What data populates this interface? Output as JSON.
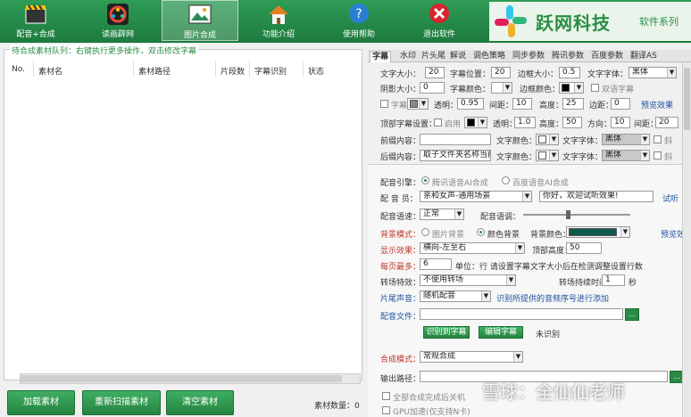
{
  "toolbar": {
    "buttons": [
      {
        "label": "配音+合成"
      },
      {
        "label": "读画辟网"
      },
      {
        "label": "图片合成"
      },
      {
        "label": "功能介绍"
      },
      {
        "label": "使用帮助"
      },
      {
        "label": "退出软件"
      }
    ],
    "brand_name": "跃网科技",
    "brand_sub": "软件系列"
  },
  "queue": {
    "title": "待合成素材队列：右键执行更多操作，双击修改字幕",
    "columns": [
      "No.",
      "素材名",
      "素材路径",
      "片段数",
      "字幕识别",
      "状态"
    ],
    "buttons": [
      "加载素材",
      "重新扫描素材",
      "清空素材"
    ],
    "count_label": "素材数量：0"
  },
  "tabs": [
    "字幕",
    "水印",
    "片头尾",
    "解说",
    "调色策略",
    "同步参数",
    "腾讯参数",
    "百度参数",
    "翻译AS"
  ],
  "subtitle": {
    "row1": {
      "size_label": "文字大小：",
      "size": "20",
      "pos_label": "字幕位置：",
      "pos": "20",
      "border_label": "边框大小：",
      "border": "0.5",
      "font_label": "文字字体：",
      "font": "黑体"
    },
    "row2": {
      "shadow_label": "阴影大小：",
      "shadow": "0",
      "color_label": "字幕颜色：",
      "bcolor_label": "边框颜色：",
      "bilingual_label": "双语字幕"
    },
    "row3": {
      "bg_label": "字幕底",
      "opacity_label": "透明：",
      "opacity": "0.95",
      "spacing_label": "间距：",
      "spacing": "10",
      "height_label": "高度：",
      "height": "25",
      "margin_label": "边距：",
      "margin": "0",
      "link": "预览效果"
    },
    "row4": {
      "extra_label": "顶部字幕设置：",
      "enable_label": "启用",
      "opacity_label": "透明：",
      "opacity": "1.0",
      "height_label": "高度：",
      "height": "50",
      "direction_label": "方向：",
      "direction": "10",
      "spacing_label": "间距：",
      "spacing": "20"
    },
    "row5": {
      "front_label": "前缀内容：",
      "front": "",
      "color_label": "文字颜色：",
      "font_label": "文字字体：",
      "font": "黑体",
      "italic_label": "斜"
    },
    "row6": {
      "back_label": "后缀内容：",
      "back": "取子文件夹名称当前标",
      "color_label": "文字颜色：",
      "font_label": "文字字体：",
      "font": "黑体",
      "italic_label": "斜"
    }
  },
  "voice": {
    "engine_label": "配音引擎：",
    "engine_opt1": "腾讯语音AI合成",
    "engine_opt2": "百度语音AI合成",
    "voice_label": "配 音 员：",
    "voice": "亲和女声-通用场景",
    "test_text": "你好，欢迎试听效果!",
    "test_link": "试听",
    "speed_label": "配音语速：",
    "speed": "正常",
    "volume_label": "配音语调："
  },
  "background": {
    "mode_label": "背景模式：",
    "opt1": "图片背景",
    "opt2": "颜色背景",
    "color_label": "背景颜色：",
    "color": "#0e5a4e",
    "link": "预览效果",
    "effect_label": "显示效果：",
    "effect": "横向-左至右",
    "height_label": "顶部高度：",
    "height": "50",
    "max_label": "每页最多：",
    "max": "6",
    "unit_label": "单位：行  请设置字幕文字大小后在检测调整设置行数"
  },
  "transition": {
    "label": "转场特效：",
    "value": "不使用转场",
    "time_label": "转场持续时间：",
    "time": "1",
    "unit": "秒"
  },
  "bgm": {
    "label": "片尾声音：",
    "value": "随机配音",
    "note": "识别所提供的音频序号进行添加"
  },
  "audio": {
    "label": "配音文件：",
    "value": "",
    "browse": "...",
    "btn1": "识别到字幕",
    "btn2": "编辑字幕",
    "status": "未识别"
  },
  "output": {
    "mode_label": "合成模式：",
    "mode": "常规合成",
    "path_label": "输出路径：",
    "path": "",
    "browse": "...",
    "opt1": "全部合成完成后关机",
    "opt2": "GPU加速(仅支持N卡)"
  },
  "watermark": "雪球：全仙仙老师"
}
